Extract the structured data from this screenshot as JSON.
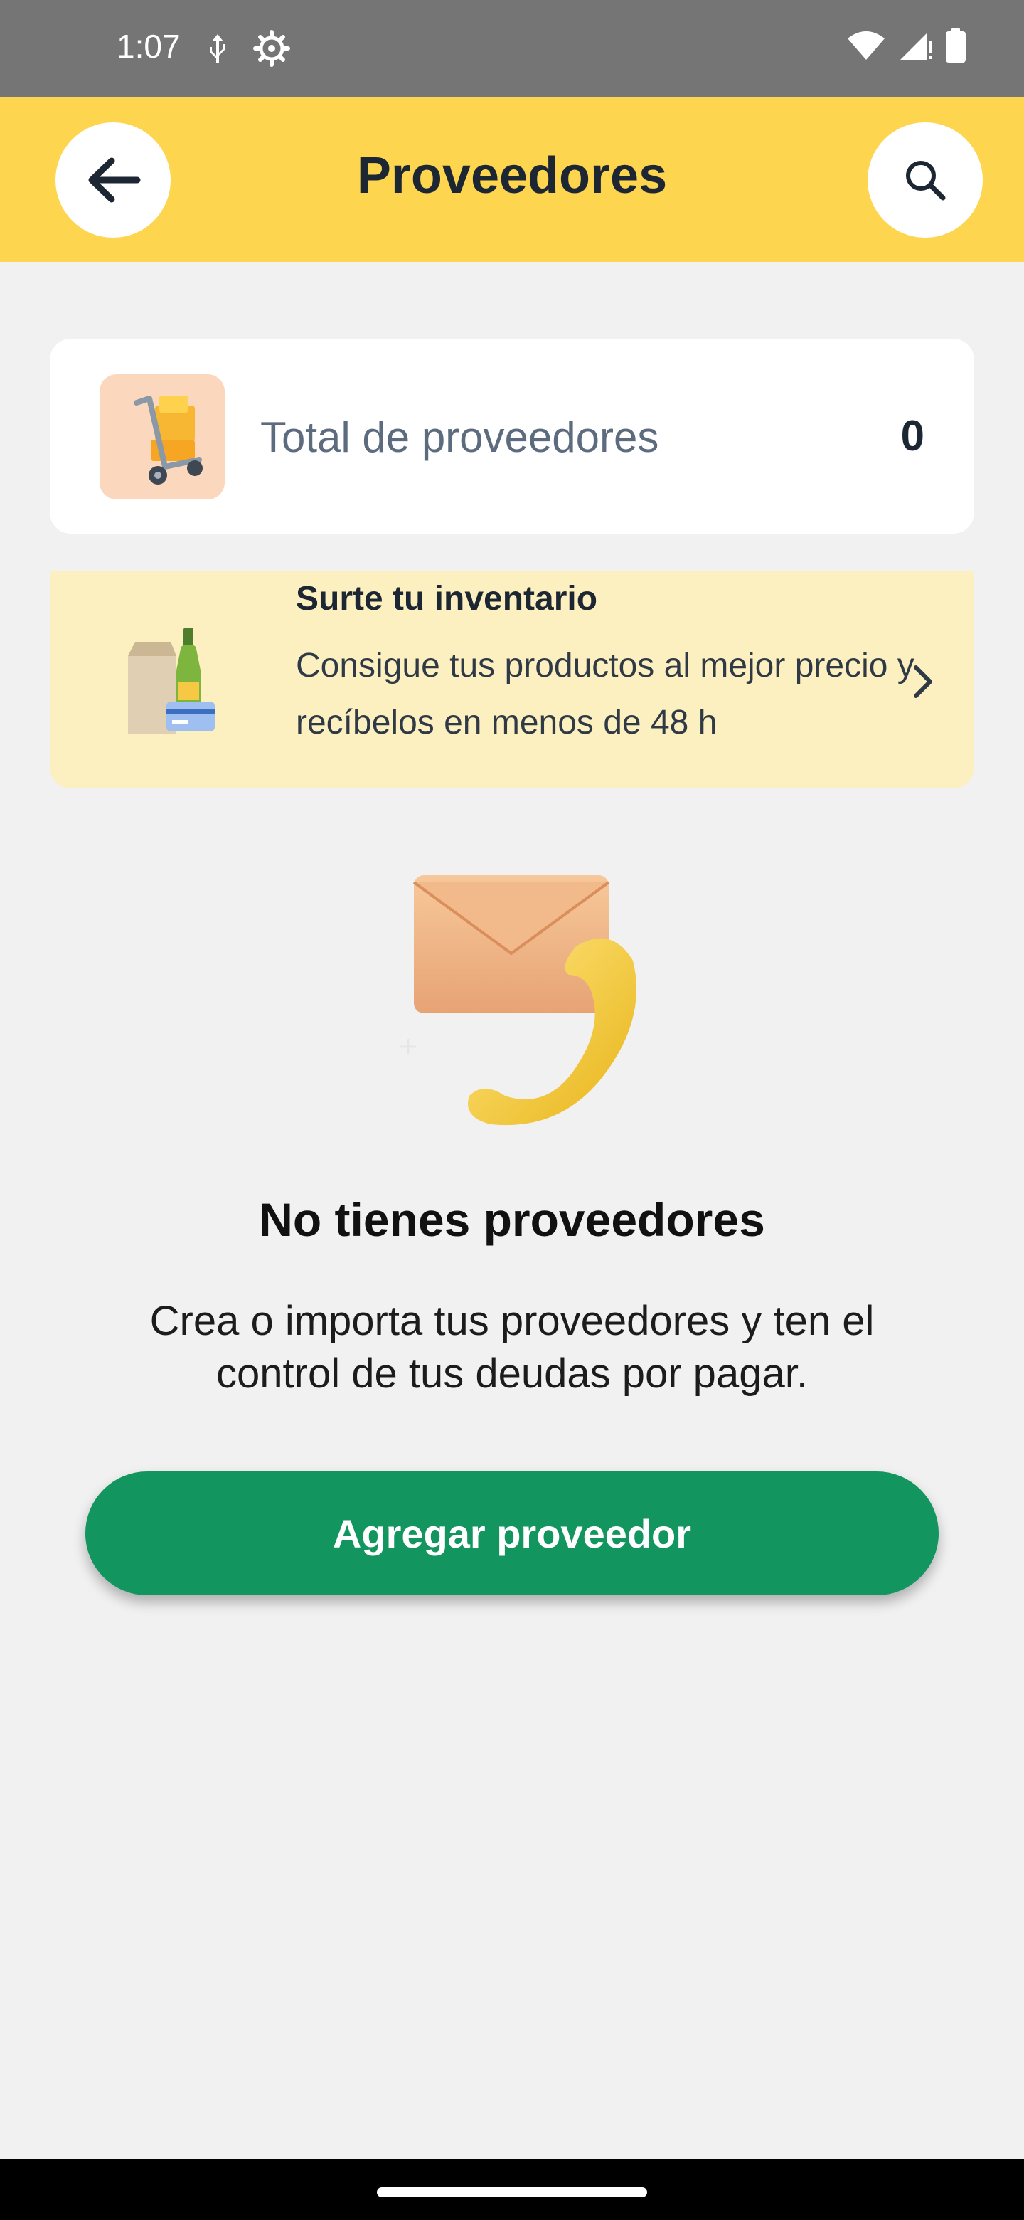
{
  "status_bar": {
    "time": "1:07"
  },
  "header": {
    "title": "Proveedores"
  },
  "summary": {
    "label": "Total de proveedores",
    "value": "0"
  },
  "promo": {
    "title": "Surte tu inventario",
    "description": "Consigue tus productos al mejor precio y recíbelos en menos de 48 h"
  },
  "empty_state": {
    "title": "No tienes proveedores",
    "description": "Crea o importa tus proveedores y ten el control de tus deudas por pagar.",
    "button_label": "Agregar proveedor"
  },
  "icons": {
    "back": "arrow-left-icon",
    "search": "search-icon",
    "promo_chevron": "chevron-right-icon"
  },
  "colors": {
    "app_bar": "#fdd54f",
    "primary_button": "#12955f",
    "promo_background": "#fdf0c0",
    "page_background": "#f1f1f1"
  }
}
